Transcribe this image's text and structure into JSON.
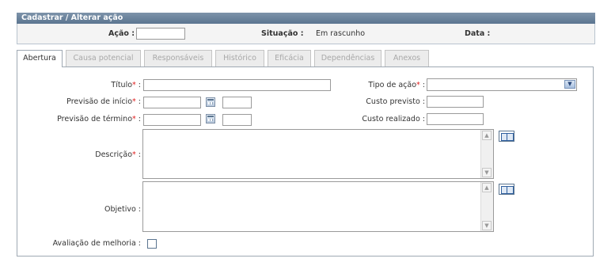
{
  "form": {
    "title": "Cadastrar / Alterar ação",
    "acao_label": "Ação :",
    "acao_value": "",
    "situacao_label": "Situação :",
    "situacao_value": "Em rascunho",
    "data_label": "Data :",
    "data_value": ""
  },
  "tabs": [
    {
      "label": "Abertura",
      "active": true
    },
    {
      "label": "Causa potencial",
      "active": false
    },
    {
      "label": "Responsáveis",
      "active": false
    },
    {
      "label": "Histórico",
      "active": false
    },
    {
      "label": "Eficácia",
      "active": false
    },
    {
      "label": "Dependências",
      "active": false
    },
    {
      "label": "Anexos",
      "active": false
    }
  ],
  "fields": {
    "titulo": {
      "label": "Título",
      "required": "*",
      "colon": ":",
      "value": ""
    },
    "previsao_inicio": {
      "label": "Previsão de início",
      "required": "*",
      "colon": ":",
      "date": "",
      "time": ""
    },
    "previsao_termino": {
      "label": "Previsão de término",
      "required": "*",
      "colon": ":",
      "date": "",
      "time": ""
    },
    "descricao": {
      "label": "Descrição",
      "required": "*",
      "colon": ":",
      "value": ""
    },
    "objetivo": {
      "label": "Objetivo :",
      "value": ""
    },
    "avaliacao": {
      "label": "Avaliação de melhoria :",
      "checked": false
    },
    "tipo_acao": {
      "label": "Tipo de ação",
      "required": "*",
      "colon": ":",
      "selected": ""
    },
    "custo_previsto": {
      "label": "Custo previsto :",
      "value": ""
    },
    "custo_realizado": {
      "label": "Custo realizado :",
      "value": ""
    }
  },
  "icons": {
    "calendar": "calendar-icon",
    "book": "book-icon",
    "dropdown": "chevron-down-icon"
  }
}
